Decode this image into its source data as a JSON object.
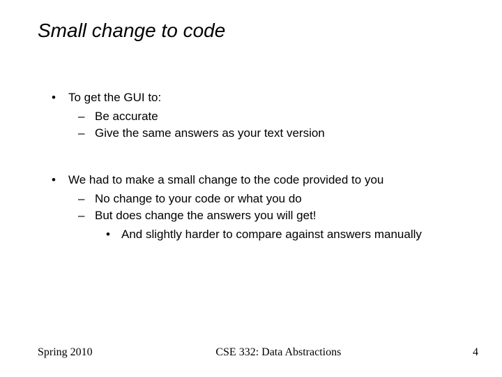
{
  "title": "Small change to code",
  "bullets": {
    "b1": "To get the GUI to:",
    "b1_1": "Be accurate",
    "b1_2": "Give the same answers as your text version",
    "b2": "We had to make a small change to the code provided to you",
    "b2_1": "No change to your code or what you do",
    "b2_2": "But does change the answers you will get!",
    "b2_2_1": "And slightly harder to compare against answers manually"
  },
  "footer": {
    "left": "Spring 2010",
    "center": "CSE 332: Data Abstractions",
    "right": "4"
  }
}
